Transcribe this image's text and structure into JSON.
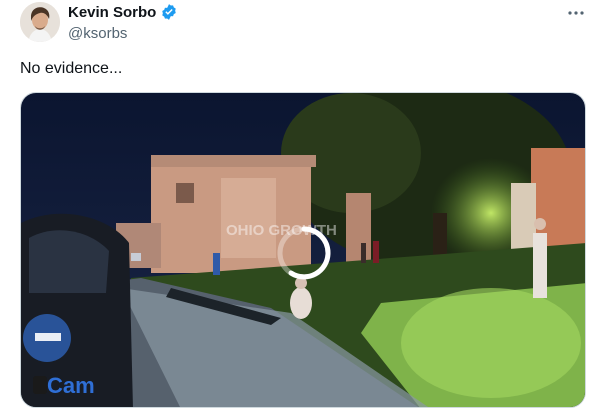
{
  "tweet": {
    "display_name": "Kevin Sorbo",
    "handle": "@ksorbs",
    "text": "No evidence...",
    "verified_color": "#1d9bf0",
    "more_icon": "more-horizontal-icon"
  },
  "media": {
    "type": "video",
    "watermark": "OHIO GROWTH",
    "bodycam_label": "Cam",
    "loading_icon": "spinner-icon"
  }
}
